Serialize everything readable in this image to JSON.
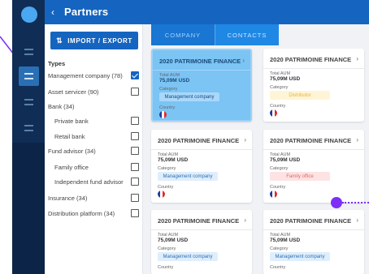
{
  "header": {
    "back_glyph": "‹",
    "title": "Partners"
  },
  "filters": {
    "import_button": {
      "icon": "swap-vert-icon",
      "glyph": "⇅",
      "label": "IMPORT / EXPORT"
    },
    "types_label": "Types",
    "items": [
      {
        "label": "Management company (78)",
        "checked": true,
        "indent": false
      },
      {
        "label": "Asset servicer (90)",
        "checked": false,
        "indent": false
      },
      {
        "label": "Bank (34)",
        "checked": null,
        "indent": false
      },
      {
        "label": "Private bank",
        "checked": false,
        "indent": true
      },
      {
        "label": "Retail bank",
        "checked": false,
        "indent": true
      },
      {
        "label": "Fund advisor (34)",
        "checked": false,
        "indent": false
      },
      {
        "label": "Family office",
        "checked": false,
        "indent": true
      },
      {
        "label": "Independent fund advisor",
        "checked": false,
        "indent": true
      },
      {
        "label": "Insurance (34)",
        "checked": false,
        "indent": false
      },
      {
        "label": "Distribution platform (34)",
        "checked": false,
        "indent": false
      }
    ]
  },
  "tabs": [
    {
      "label": "COMPANY",
      "active": true
    },
    {
      "label": "CONTACTS",
      "active": false
    }
  ],
  "cards": [
    {
      "name": "2020 PATRIMOINE FINANCE",
      "aum_label": "Total AUM",
      "aum": "75,09M USD",
      "category_label": "Category",
      "category": "Management company",
      "category_color": "blue",
      "country_label": "Country",
      "selected": true
    },
    {
      "name": "2020 PATRIMOINE FINANCE",
      "aum_label": "Total AUM",
      "aum": "75,09M USD",
      "category_label": "Category",
      "category": "Distributor",
      "category_color": "yellow",
      "country_label": "Country",
      "selected": false
    },
    {
      "name": "2020 PATRIMOINE FINANCE",
      "aum_label": "Total AUM",
      "aum": "75,09M USD",
      "category_label": "Category",
      "category": "Management company",
      "category_color": "blue",
      "country_label": "Country",
      "selected": false
    },
    {
      "name": "2020 PATRIMOINE FINANCE",
      "aum_label": "Total AUM",
      "aum": "75,09M USD",
      "category_label": "Category",
      "category": "Family office",
      "category_color": "red",
      "country_label": "Country",
      "selected": false
    },
    {
      "name": "2020 PATRIMOINE FINANCE",
      "aum_label": "Total AUM",
      "aum": "75,09M USD",
      "category_label": "Category",
      "category": "Management company",
      "category_color": "blue",
      "country_label": "Country",
      "selected": false
    },
    {
      "name": "2020 PATRIMOINE FINANCE",
      "aum_label": "Total AUM",
      "aum": "75,09M USD",
      "category_label": "Category",
      "category": "Management company",
      "category_color": "blue",
      "country_label": "Country",
      "selected": false
    }
  ],
  "colors": {
    "sidebar": "#0f2d55",
    "header": "#1565c0",
    "accent": "#7b2ff7"
  }
}
